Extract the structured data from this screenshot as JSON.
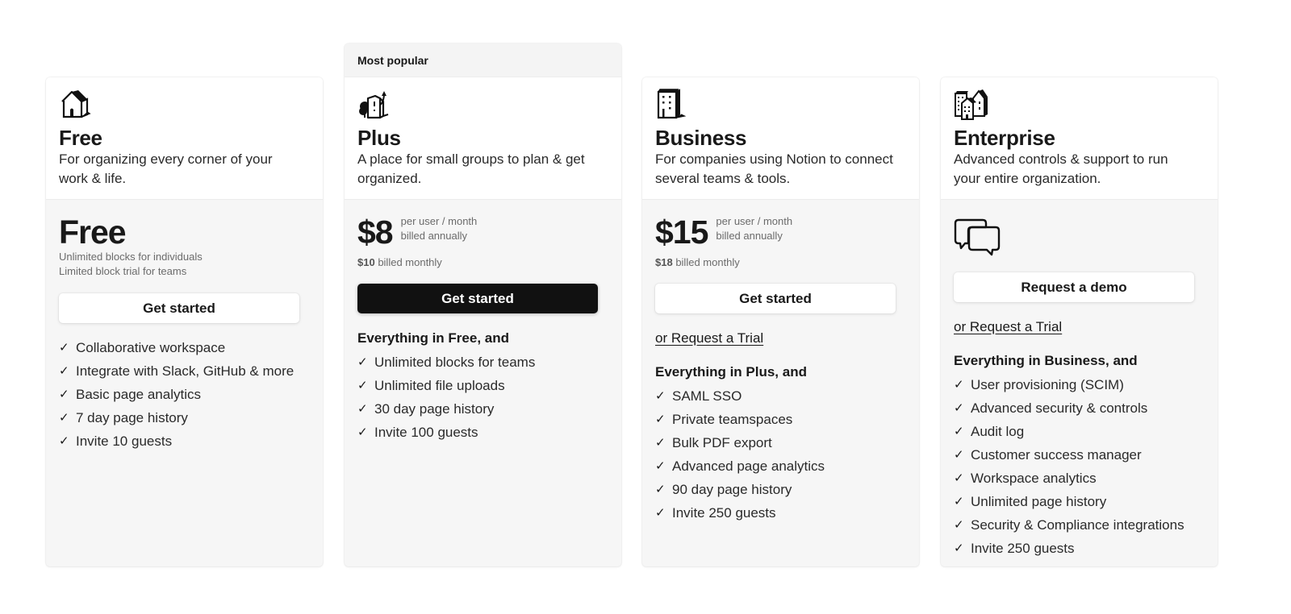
{
  "plans": [
    {
      "id": "free",
      "icon": "house-icon",
      "name": "Free",
      "description": "For organizing every corner of your work & life.",
      "price": "Free",
      "price_subtext": [
        "Unlimited blocks for individuals",
        "Limited block trial for teams"
      ],
      "cta_label": "Get started",
      "features_heading": "",
      "features": [
        "Collaborative workspace",
        "Integrate with Slack, GitHub & more",
        "Basic page analytics",
        "7 day page history",
        "Invite 10 guests"
      ]
    },
    {
      "id": "plus",
      "badge": "Most popular",
      "icon": "small-building-icon",
      "name": "Plus",
      "description": "A place for small groups to plan & get organized.",
      "price": "$8",
      "price_note": [
        "per user / month",
        "billed annually"
      ],
      "monthly_price": "$10",
      "monthly_label": " billed monthly",
      "cta_label": "Get started",
      "features_heading": "Everything in Free, and",
      "features": [
        "Unlimited blocks for teams",
        "Unlimited file uploads",
        "30 day page history",
        "Invite 100 guests"
      ]
    },
    {
      "id": "business",
      "icon": "office-building-icon",
      "name": "Business",
      "description": "For companies using Notion to connect several teams & tools.",
      "price": "$15",
      "price_note": [
        "per user / month",
        "billed annually"
      ],
      "monthly_price": "$18",
      "monthly_label": " billed monthly",
      "cta_label": "Get started",
      "trial_link": "or Request a Trial",
      "features_heading": "Everything in Plus, and",
      "features": [
        "SAML SSO",
        "Private teamspaces",
        "Bulk PDF export",
        "Advanced page analytics",
        "90 day page history",
        "Invite 250 guests"
      ]
    },
    {
      "id": "enterprise",
      "icon": "city-buildings-icon",
      "name": "Enterprise",
      "description": "Advanced controls & support to run your entire organization.",
      "price_icon": "chat-bubbles-icon",
      "cta_label": "Request a demo",
      "trial_link": "or Request a Trial",
      "features_heading": "Everything in Business, and",
      "features": [
        "User provisioning (SCIM)",
        "Advanced security & controls",
        "Audit log",
        "Customer success manager",
        "Workspace analytics",
        "Unlimited page history",
        "Security & Compliance integrations",
        "Invite 250 guests"
      ]
    }
  ],
  "check_glyph": "✓"
}
